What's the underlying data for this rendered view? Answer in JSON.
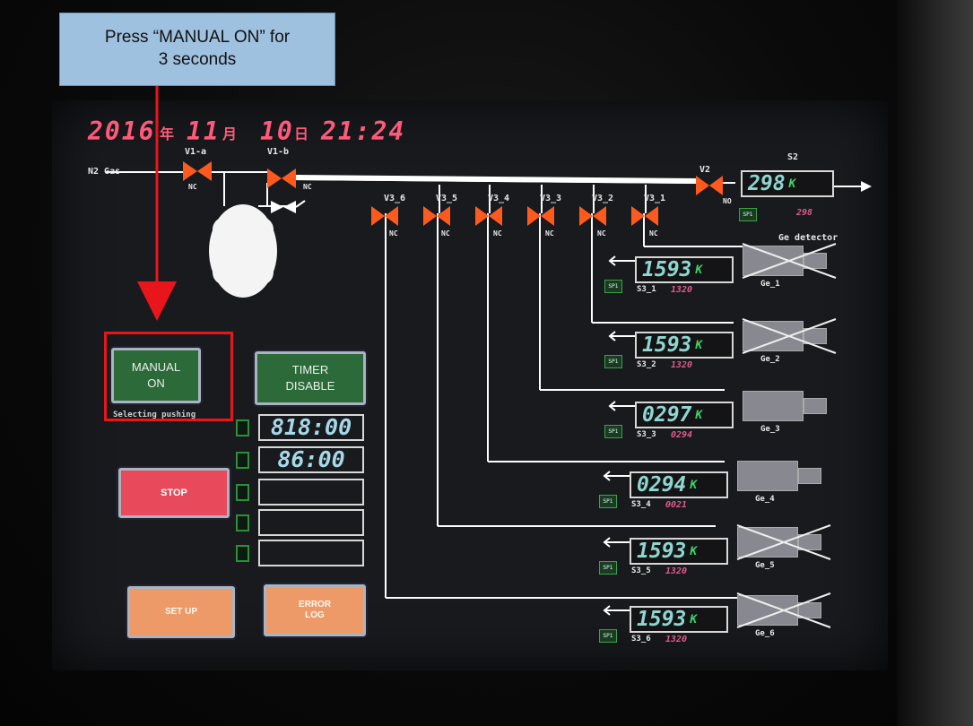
{
  "callout": {
    "line1": "Press “MANUAL ON” for",
    "line2": "3 seconds"
  },
  "datetime": {
    "year": "2016",
    "year_kanji": "年",
    "month": "11",
    "month_kanji": "月",
    "day": "10",
    "day_kanji": "日",
    "time": "21:24"
  },
  "valves": {
    "v1a": "V1-a",
    "v1b": "V1-b",
    "v2": "V2",
    "v3_6": "V3_6",
    "v3_5": "V3_5",
    "v3_4": "V3_4",
    "v3_3": "V3_3",
    "v3_2": "V3_2",
    "v3_1": "V3_1",
    "nc": "NC",
    "no": "NO"
  },
  "n2_gas": "N2 Gas",
  "s2": {
    "label": "S2",
    "value": "298",
    "unit": "K",
    "sp": "SP1",
    "cal": "298"
  },
  "ge_header": "Ge detector",
  "sensors": [
    {
      "value": "1593",
      "unit": "K",
      "sensor": "S3_1",
      "cal": "1320",
      "detector": "Ge_1",
      "sp": "SP1",
      "crossed": true
    },
    {
      "value": "1593",
      "unit": "K",
      "sensor": "S3_2",
      "cal": "1320",
      "detector": "Ge_2",
      "sp": "SP1",
      "crossed": true
    },
    {
      "value": "0297",
      "unit": "K",
      "sensor": "S3_3",
      "cal": "0294",
      "detector": "Ge_3",
      "sp": "SP1",
      "crossed": false
    },
    {
      "value": "0294",
      "unit": "K",
      "sensor": "S3_4",
      "cal": "0021",
      "detector": "Ge_4",
      "sp": "SP1",
      "crossed": false
    },
    {
      "value": "1593",
      "unit": "K",
      "sensor": "S3_5",
      "cal": "1320",
      "detector": "Ge_5",
      "sp": "SP1",
      "crossed": true
    },
    {
      "value": "1593",
      "unit": "K",
      "sensor": "S3_6",
      "cal": "1320",
      "detector": "Ge_6",
      "sp": "SP1",
      "crossed": true
    }
  ],
  "buttons": {
    "manual_line1": "MANUAL",
    "manual_line2": "ON",
    "timer_line1": "TIMER",
    "timer_line2": "DISABLE",
    "stop": "STOP",
    "setup": "SET UP",
    "error_line1": "ERROR",
    "error_line2": "LOG"
  },
  "subtext": "Selecting pushing",
  "timers": [
    "818:00",
    "86:00",
    "",
    "",
    ""
  ],
  "colors": {
    "valve": "#ff5a1e",
    "pipe": "#ffffff",
    "callout": "#9fc1e0",
    "highlight": "#e8161b",
    "arrow": "#e8161b"
  }
}
